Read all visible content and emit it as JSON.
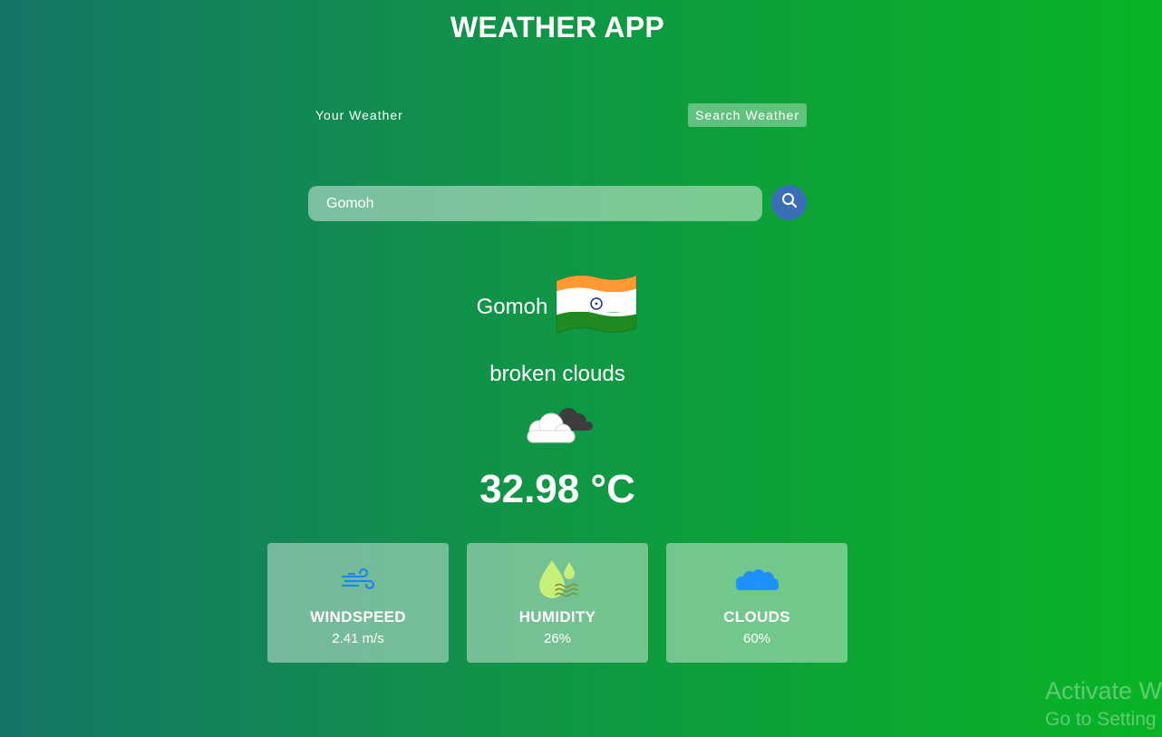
{
  "app": {
    "title": "WEATHER APP"
  },
  "tabs": {
    "your_weather": "Your Weather",
    "search_weather": "Search Weather"
  },
  "search": {
    "value": "Gomoh",
    "button_icon": "search-icon"
  },
  "weather": {
    "city": "Gomoh",
    "flag_icon": "india-flag-icon",
    "description": "broken clouds",
    "condition_icon": "broken-clouds-icon",
    "temperature": "32.98 °C"
  },
  "cards": [
    {
      "label": "WINDSPEED",
      "value": "2.41 m/s",
      "icon": "wind-icon"
    },
    {
      "label": "HUMIDITY",
      "value": "26%",
      "icon": "humidity-icon"
    },
    {
      "label": "CLOUDS",
      "value": "60%",
      "icon": "clouds-icon"
    }
  ],
  "watermark": {
    "title": "Activate W",
    "subtitle": "Go to Setting"
  },
  "colors": {
    "gradient_left": "#157566",
    "gradient_right": "#08b425",
    "search_button": "#3a6fb5"
  }
}
